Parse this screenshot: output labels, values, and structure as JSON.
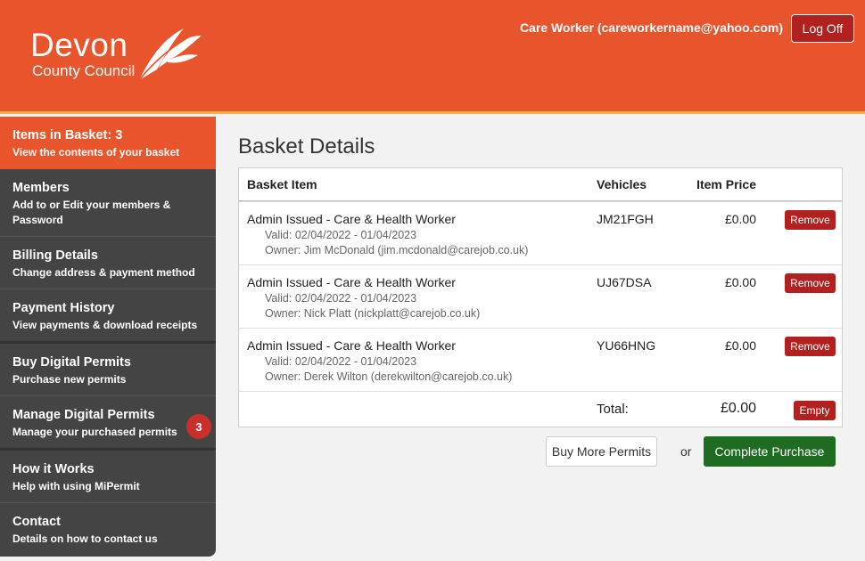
{
  "header": {
    "logo_line1": "Devon",
    "logo_line2": "County Council",
    "user_label": "Care Worker (careworkername@yahoo.com)",
    "logoff_label": "Log Off",
    "brand_color": "#e8542c"
  },
  "sidebar": {
    "items": [
      {
        "title": "Items in Basket: 3",
        "sub": "View the contents of your basket"
      },
      {
        "title": "Members",
        "sub": "Add to or Edit your members & Password"
      },
      {
        "title": "Billing Details",
        "sub": "Change address & payment method"
      },
      {
        "title": "Payment History",
        "sub": "View payments & download receipts"
      },
      {
        "title": "Buy Digital Permits",
        "sub": "Purchase new permits"
      },
      {
        "title": "Manage Digital Permits",
        "sub": "Manage your purchased permits",
        "badge": "3"
      },
      {
        "title": "How it Works",
        "sub": "Help with using MiPermit"
      },
      {
        "title": "Contact",
        "sub": "Details on how to contact us"
      }
    ]
  },
  "main": {
    "title": "Basket Details",
    "columns": {
      "item": "Basket Item",
      "vehicles": "Vehicles",
      "price": "Item Price"
    },
    "rows": [
      {
        "title": "Admin Issued - Care & Health Worker",
        "valid": "Valid: 02/04/2022 - 01/04/2023",
        "owner": "Owner: Jim McDonald (jim.mcdonald@carejob.co.uk)",
        "vehicle": "JM21FGH",
        "price": "£0.00",
        "remove": "Remove"
      },
      {
        "title": "Admin Issued - Care & Health Worker",
        "valid": "Valid: 02/04/2022 - 01/04/2023",
        "owner": "Owner: Nick Platt (nickplatt@carejob.co.uk)",
        "vehicle": "UJ67DSA",
        "price": "£0.00",
        "remove": "Remove"
      },
      {
        "title": "Admin Issued - Care & Health Worker",
        "valid": "Valid: 02/04/2022 - 01/04/2023",
        "owner": "Owner: Derek Wilton (derekwilton@carejob.co.uk)",
        "vehicle": "YU66HNG",
        "price": "£0.00",
        "remove": "Remove"
      }
    ],
    "total_label": "Total:",
    "total_value": "£0.00",
    "empty_label": "Empty",
    "buy_more_label": "Buy More Permits",
    "or_label": "or",
    "complete_label": "Complete Purchase"
  }
}
